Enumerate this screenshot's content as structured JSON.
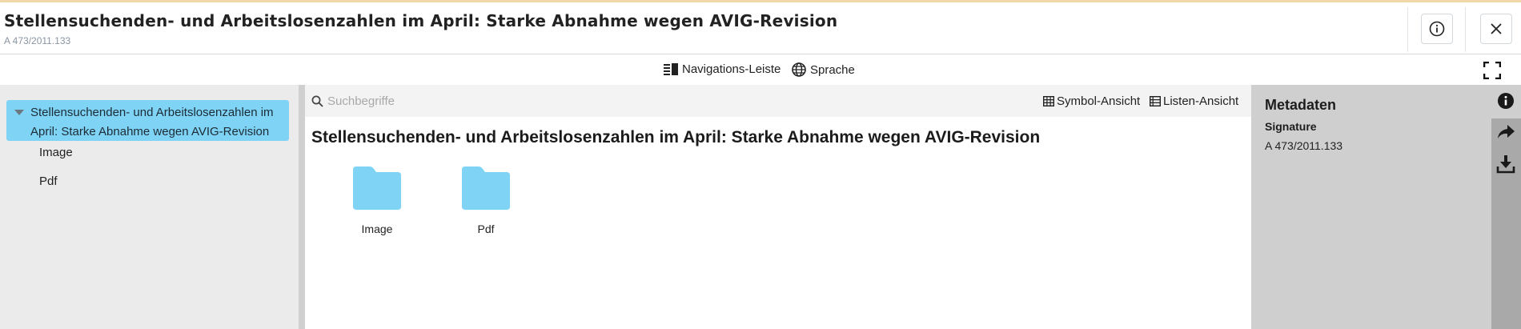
{
  "header": {
    "title": "Stellensuchenden- und Arbeitslosenzahlen im April: Starke Abnahme wegen AVIG-Revision",
    "subtitle": "A 473/2011.133",
    "info_icon": "info-circle-icon",
    "close_icon": "close-icon"
  },
  "toolbar": {
    "navigation_label": "Navigations-Leiste",
    "language_label": "Sprache"
  },
  "tree": {
    "root_label": "Stellensuchenden- und Arbeitslosenzahlen im April: Starke Abnahme wegen AVIG-Revision",
    "children": [
      "Image",
      "Pdf"
    ]
  },
  "search": {
    "placeholder": "Suchbegriffe",
    "symbol_view_label": "Symbol-Ansicht",
    "list_view_label": "Listen-Ansicht"
  },
  "content": {
    "title": "Stellensuchenden- und Arbeitslosenzahlen im April: Starke Abnahme wegen AVIG-Revision",
    "folders": [
      {
        "label": "Image"
      },
      {
        "label": "Pdf"
      }
    ]
  },
  "metadata": {
    "title": "Metadaten",
    "signature_label": "Signature",
    "signature_value": "A 473/2011.133"
  },
  "colors": {
    "selected_bg": "#7fd4f5",
    "folder": "#7fd4f5",
    "top_accent": "#f1d7a7"
  }
}
